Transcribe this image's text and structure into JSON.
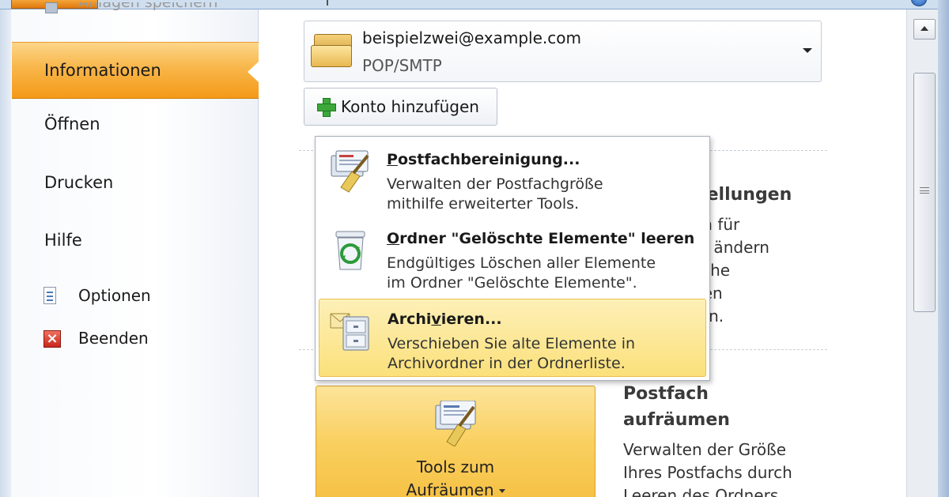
{
  "titlebar": {
    "help_icon": "help-circle-icon"
  },
  "nav": {
    "save_attachments": "Anlagen speichern",
    "information": "Informationen",
    "open": "Öffnen",
    "print": "Drucken",
    "help": "Hilfe",
    "options": "Optionen",
    "exit": "Beenden"
  },
  "account": {
    "email": "beispielzwei@example.com",
    "type": "POP/SMTP",
    "add_label": "Konto hinzufügen"
  },
  "account_settings": {
    "title_fragment": "stellungen",
    "lines": [
      "en für",
      "to ändern",
      "liche",
      "gen",
      "ren."
    ]
  },
  "menu": {
    "items": [
      {
        "title_first": "P",
        "title_rest": "ostfachbereinigung...",
        "desc1": "Verwalten der Postfachgröße",
        "desc2": "mithilfe erweiterter Tools.",
        "icon": "mailbox-cleanup-icon"
      },
      {
        "title_first": "O",
        "title_rest": "rdner \"Gelöschte Elemente\" leeren",
        "desc1": "Endgültiges Löschen aller Elemente",
        "desc2": "im Ordner \"Gelöschte Elemente\".",
        "icon": "recycle-bin-icon"
      },
      {
        "title_before": "Archi",
        "title_key": "v",
        "title_after": "ieren...",
        "desc1": "Verschieben Sie alte Elemente in",
        "desc2": "Archivordner in der Ordnerliste.",
        "icon": "archive-cabinet-icon"
      }
    ]
  },
  "cleanup_tools": {
    "label_line1": "Tools zum",
    "label_line2": "Aufräumen"
  },
  "mailbox": {
    "title_line1": "Postfach",
    "title_line2": "aufräumen",
    "lines": [
      "Verwalten der Größe",
      "Ihres Postfachs durch",
      "Leeren des Ordners"
    ]
  },
  "colors": {
    "accent_orange": "#f49a18",
    "highlight_yellow": "#fbe07a",
    "nav_background": "#f7f9fc"
  }
}
